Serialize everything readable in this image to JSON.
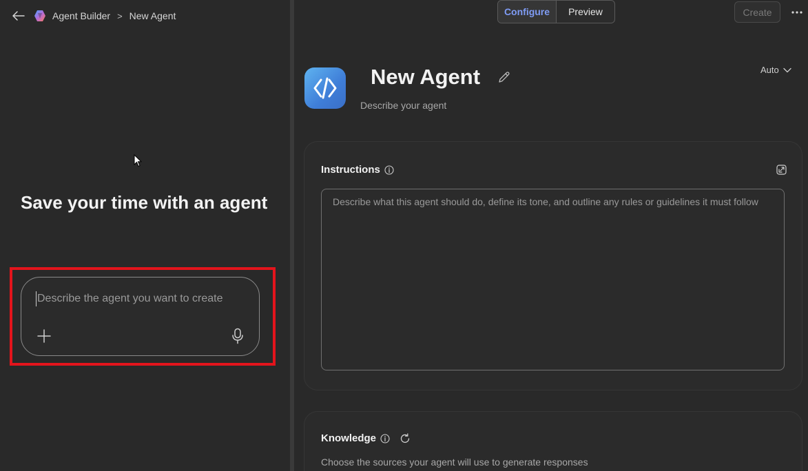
{
  "breadcrumb": {
    "root": "Agent Builder",
    "separator": ">",
    "current": "New Agent"
  },
  "left": {
    "headline": "Save your time with an agent",
    "composer_placeholder": "Describe the agent you want to create"
  },
  "top_tabs": [
    {
      "label": "Configure",
      "active": true
    },
    {
      "label": "Preview",
      "active": false
    }
  ],
  "create_label": "Create",
  "agent": {
    "name": "New Agent",
    "description_placeholder": "Describe your agent",
    "model_select": "Auto"
  },
  "instructions": {
    "title": "Instructions",
    "placeholder": "Describe what this agent should do, define its tone, and outline any rules or guidelines it must follow"
  },
  "knowledge": {
    "title": "Knowledge",
    "subtitle": "Choose the sources your agent will use to generate responses"
  },
  "colors": {
    "background": "#292929",
    "accent": "#7f9cf5",
    "highlight": "#e3141c",
    "agent_icon_start": "#5fb3f0",
    "agent_icon_end": "#3a6fc7"
  },
  "icons": [
    "back-arrow-icon",
    "copilot-logo-icon",
    "plus-icon",
    "microphone-icon",
    "more-icon",
    "code-icon",
    "pencil-icon",
    "chevron-down-icon",
    "info-icon",
    "expand-icon",
    "refresh-icon"
  ]
}
